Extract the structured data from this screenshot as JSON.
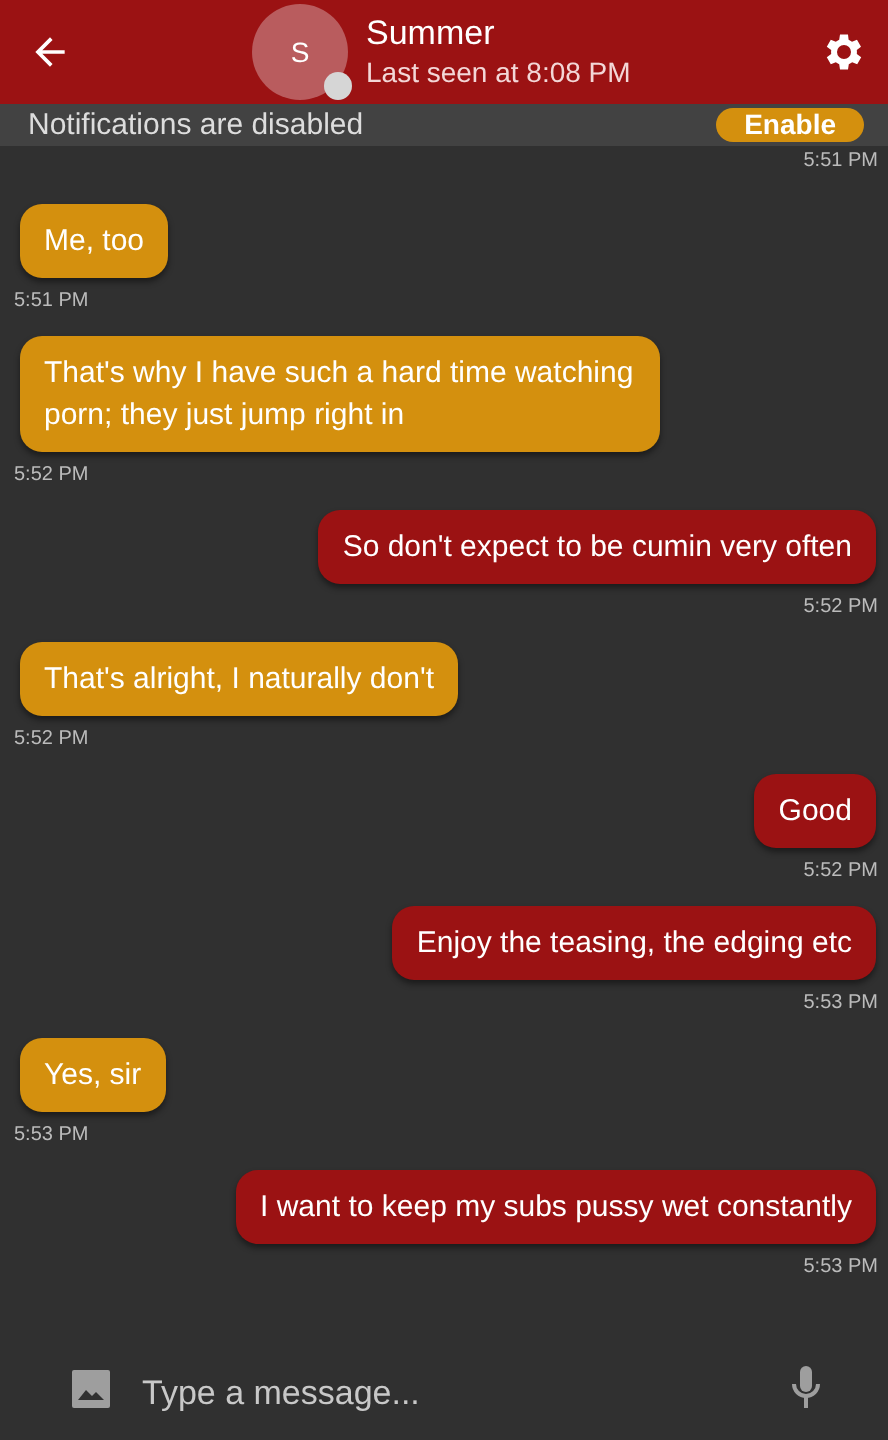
{
  "header": {
    "name": "Summer",
    "avatar_letter": "S",
    "online": false,
    "status": "Last seen at 8:08 PM"
  },
  "notice": {
    "text": "Notifications are disabled",
    "button": "Enable"
  },
  "earlier_time": "5:51 PM",
  "messages": [
    {
      "kind": "received",
      "text": "Me, too",
      "time": "5:51 PM"
    },
    {
      "kind": "received",
      "text": "That's why I have such a hard time watching porn; they just jump right in",
      "time": "5:52 PM"
    },
    {
      "kind": "sent",
      "text": "So don't expect to be cumin very often",
      "time": "5:52 PM"
    },
    {
      "kind": "received",
      "text": "That's alright, I naturally don't",
      "time": "5:52 PM"
    },
    {
      "kind": "sent",
      "text": "Good",
      "time": "5:52 PM"
    },
    {
      "kind": "sent",
      "text": "Enjoy the teasing, the edging etc",
      "time": "5:53 PM"
    },
    {
      "kind": "received",
      "text": "Yes, sir",
      "time": "5:53 PM"
    },
    {
      "kind": "sent",
      "text": "I want to keep my subs pussy wet constantly",
      "time": "5:53 PM"
    }
  ],
  "composer": {
    "placeholder": "Type a message..."
  }
}
